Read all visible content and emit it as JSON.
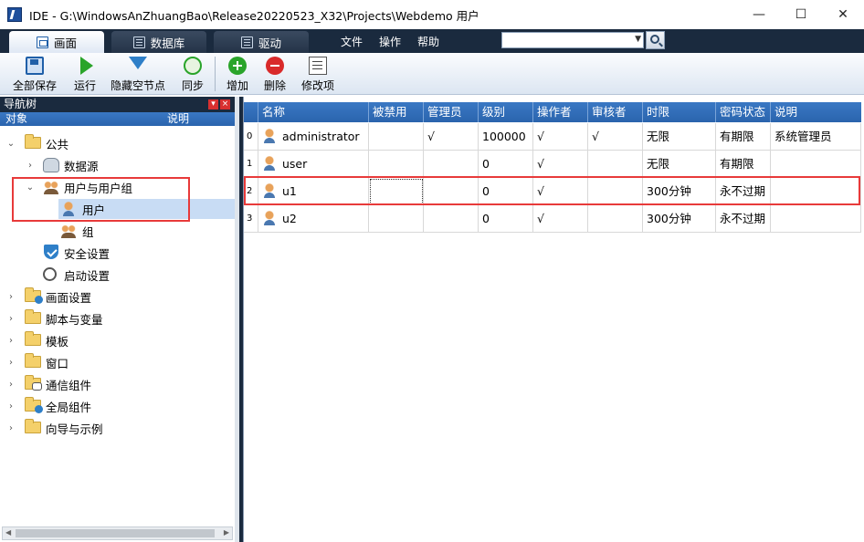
{
  "window": {
    "title": "IDE - G:\\WindowsAnZhuangBao\\Release20220523_X32\\Projects\\Webdemo  用户",
    "minimize": "—",
    "maximize": "☐",
    "close": "✕"
  },
  "menubar": {
    "tabs": [
      {
        "label": "画面",
        "active": true
      },
      {
        "label": "数据库",
        "active": false
      },
      {
        "label": "驱动",
        "active": false
      }
    ],
    "menus": [
      "文件",
      "操作",
      "帮助"
    ],
    "search_value": ""
  },
  "toolbar": {
    "save_all": "全部保存",
    "run": "运行",
    "hide_empty": "隐藏空节点",
    "sync": "同步",
    "add": "增加",
    "delete": "删除",
    "edit": "修改项"
  },
  "nav": {
    "title": "导航树",
    "col_object": "对象",
    "col_desc": "说明",
    "items": [
      {
        "label": "公共"
      },
      {
        "label": "数据源"
      },
      {
        "label": "用户与用户组"
      },
      {
        "label": "用户"
      },
      {
        "label": "组"
      },
      {
        "label": "安全设置"
      },
      {
        "label": "启动设置"
      },
      {
        "label": "画面设置"
      },
      {
        "label": "脚本与变量"
      },
      {
        "label": "模板"
      },
      {
        "label": "窗口"
      },
      {
        "label": "通信组件"
      },
      {
        "label": "全局组件"
      },
      {
        "label": "向导与示例"
      }
    ]
  },
  "grid": {
    "headers": [
      "名称",
      "被禁用",
      "管理员",
      "级别",
      "操作者",
      "审核者",
      "时限",
      "密码状态",
      "说明"
    ],
    "rows": [
      {
        "idx": "0",
        "name": "administrator",
        "disabled": "",
        "admin": "√",
        "level": "100000",
        "operator": "√",
        "auditor": "√",
        "limit": "无限",
        "pwd": "有期限",
        "desc": "系统管理员"
      },
      {
        "idx": "1",
        "name": "user",
        "disabled": "",
        "admin": "",
        "level": "0",
        "operator": "√",
        "auditor": "",
        "limit": "无限",
        "pwd": "有期限",
        "desc": ""
      },
      {
        "idx": "2",
        "name": "u1",
        "disabled": "",
        "admin": "",
        "level": "0",
        "operator": "√",
        "auditor": "",
        "limit": "300分钟",
        "pwd": "永不过期",
        "desc": ""
      },
      {
        "idx": "3",
        "name": "u2",
        "disabled": "",
        "admin": "",
        "level": "0",
        "operator": "√",
        "auditor": "",
        "limit": "300分钟",
        "pwd": "永不过期",
        "desc": ""
      }
    ]
  },
  "colors": {
    "dark_bar": "#1a2a3e",
    "header_blue": "#2a64ad",
    "highlight_red": "#e83a3a",
    "selected_row": "#c8dcf4"
  }
}
